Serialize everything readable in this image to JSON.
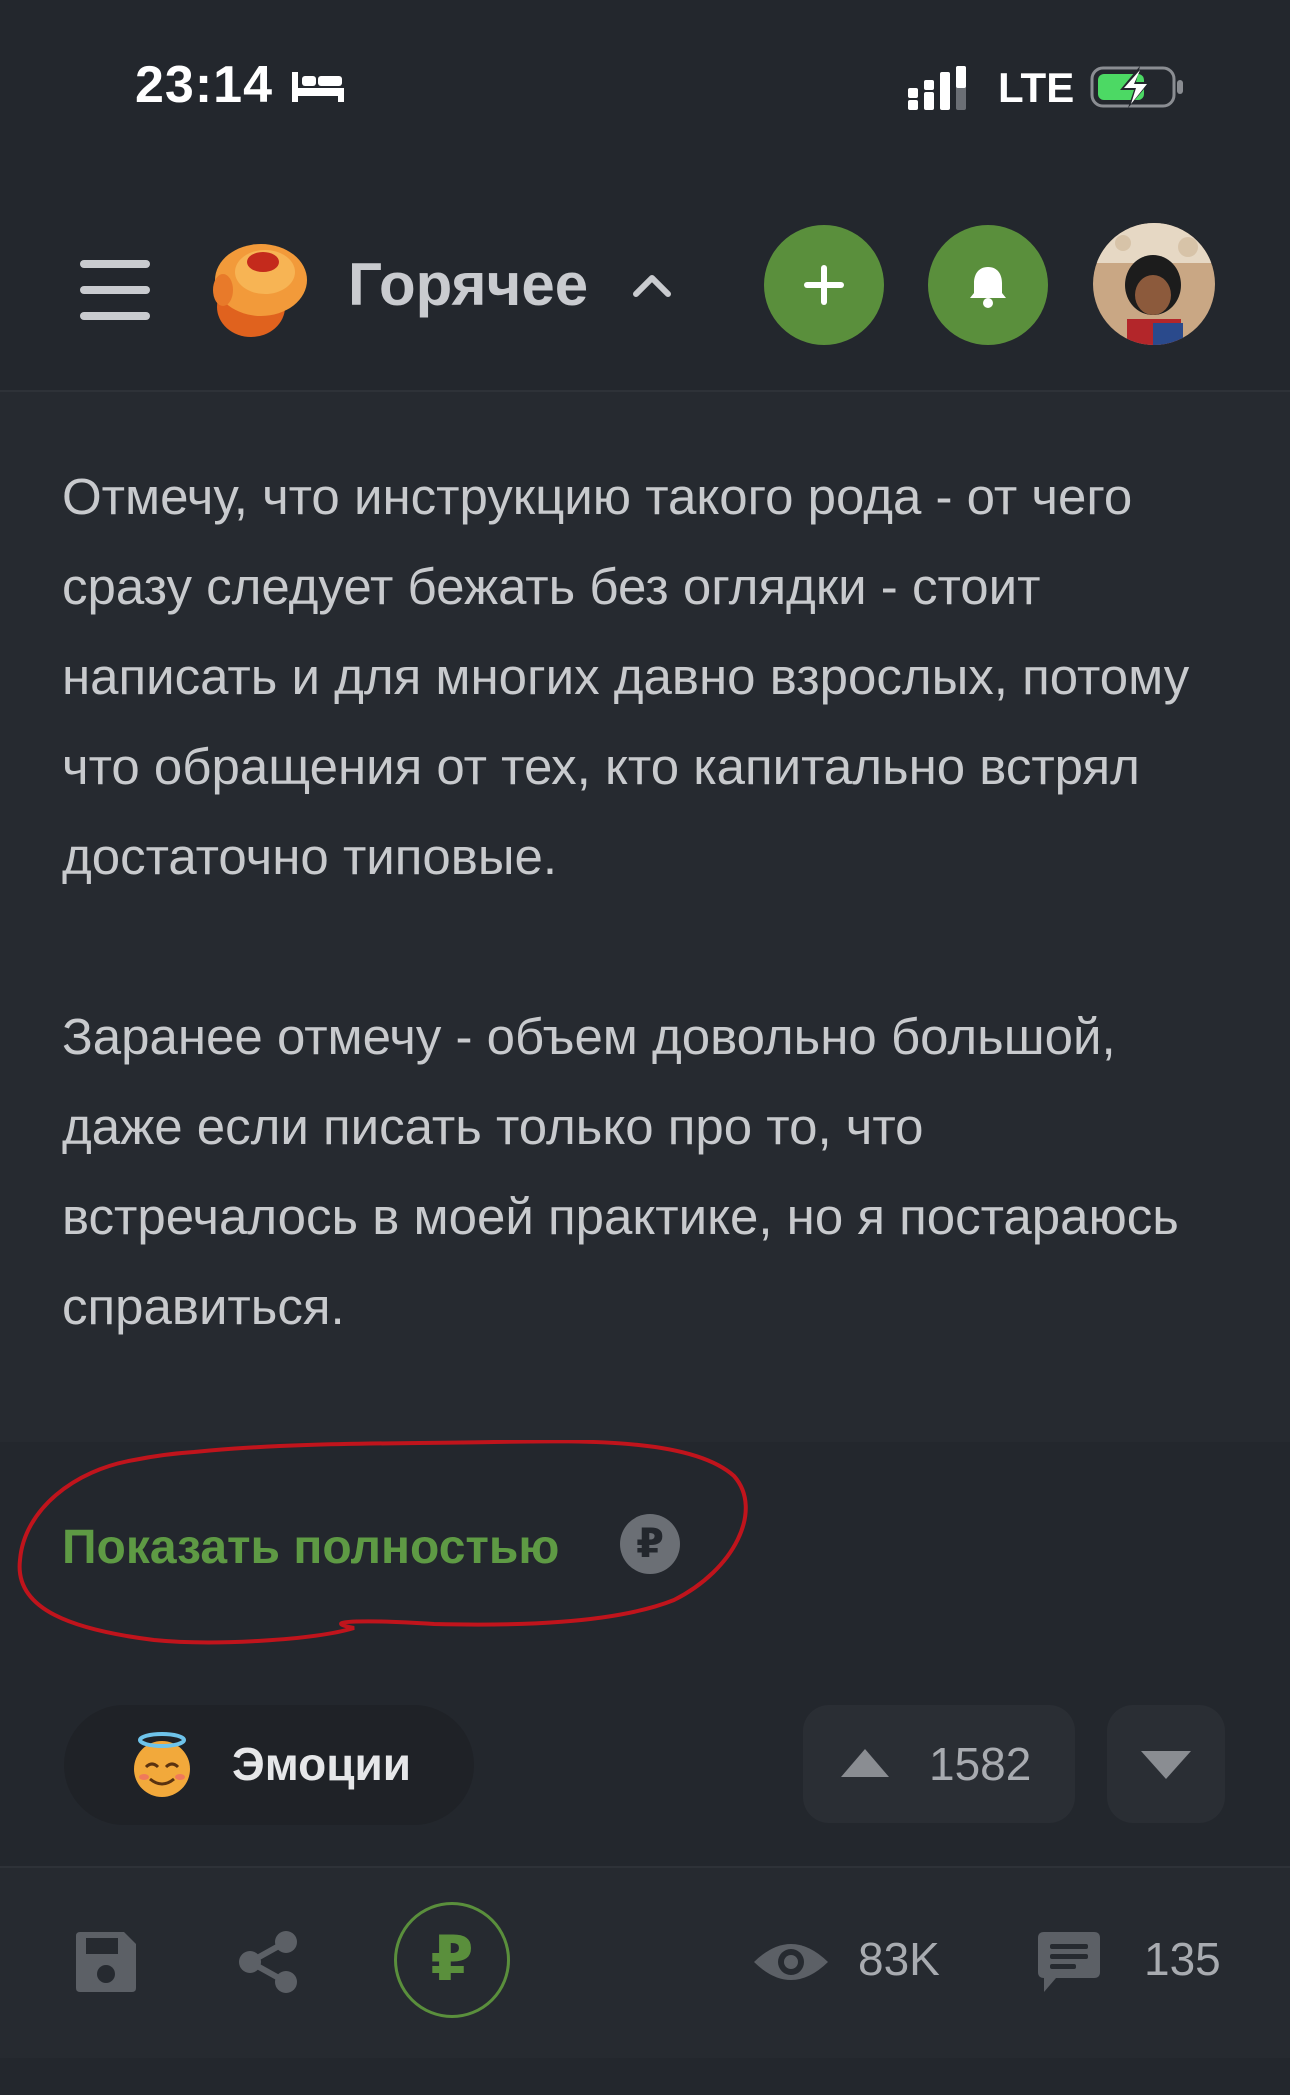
{
  "status_bar": {
    "time": "23:14",
    "network": "LTE",
    "icons": [
      "bed-icon",
      "signal-icon",
      "battery-charging-icon"
    ]
  },
  "header": {
    "title": "Горячее",
    "icons": [
      "menu-icon",
      "logo-icon",
      "chevron-up-icon",
      "add-icon",
      "bell-icon",
      "avatar"
    ]
  },
  "post": {
    "text": "Отмечу, что инструкцию такого рода - от чего сразу следует бежать без оглядки - стоит написать и для многих давно взрослых, потому что обращения от тех, кто капитально встрял достаточно типовые.\n\nЗаранее отмечу - объем довольно большой, даже если писать только про то, что встречалось в моей практике, но я постараюсь справиться.",
    "show_more_label": "Показать полностью",
    "ruble_symbol": "₽"
  },
  "actions": {
    "emotions_label": "Эмоции",
    "rating": "1582"
  },
  "bottom_bar": {
    "donate_symbol": "₽",
    "views": "83K",
    "comments": "135"
  },
  "colors": {
    "background": "#23272d",
    "accent_green": "#5a8f3c",
    "annotation_red": "#c0141c"
  }
}
